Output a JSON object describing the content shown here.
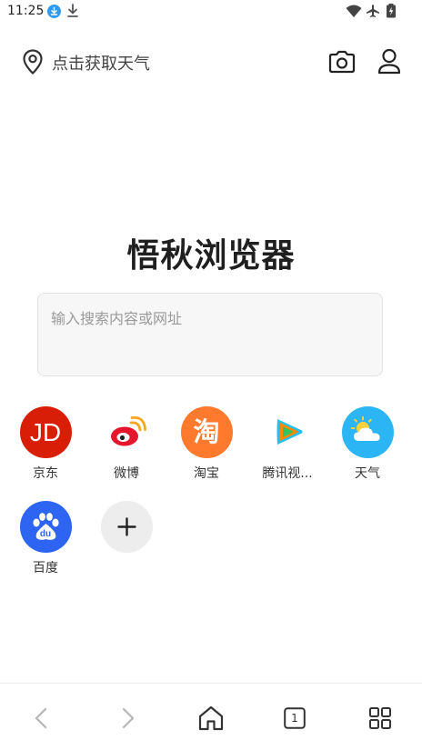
{
  "status_bar": {
    "time": "11:25"
  },
  "topbar": {
    "weather_label": "点击获取天气"
  },
  "brand": {
    "title": "悟秋浏览器"
  },
  "search": {
    "placeholder": "输入搜索内容或网址",
    "value": ""
  },
  "shortcuts": [
    {
      "label": "京东",
      "icon": "jd-icon",
      "color": "#d81e06",
      "glyph": "JD"
    },
    {
      "label": "微博",
      "icon": "weibo-icon",
      "color": "#ffffff"
    },
    {
      "label": "淘宝",
      "icon": "taobao-icon",
      "color": "#ff7a2c",
      "glyph": "淘"
    },
    {
      "label": "腾讯视...",
      "icon": "tencent-video-icon",
      "color": "#ffffff"
    },
    {
      "label": "天气",
      "icon": "weather-icon",
      "color": "#2bb5f5"
    },
    {
      "label": "百度",
      "icon": "baidu-icon",
      "color": "#2e64f2",
      "glyph": "du"
    },
    {
      "label": "",
      "icon": "plus-icon",
      "color": "#ededed"
    }
  ],
  "bottom_nav": {
    "tab_count": "1"
  }
}
